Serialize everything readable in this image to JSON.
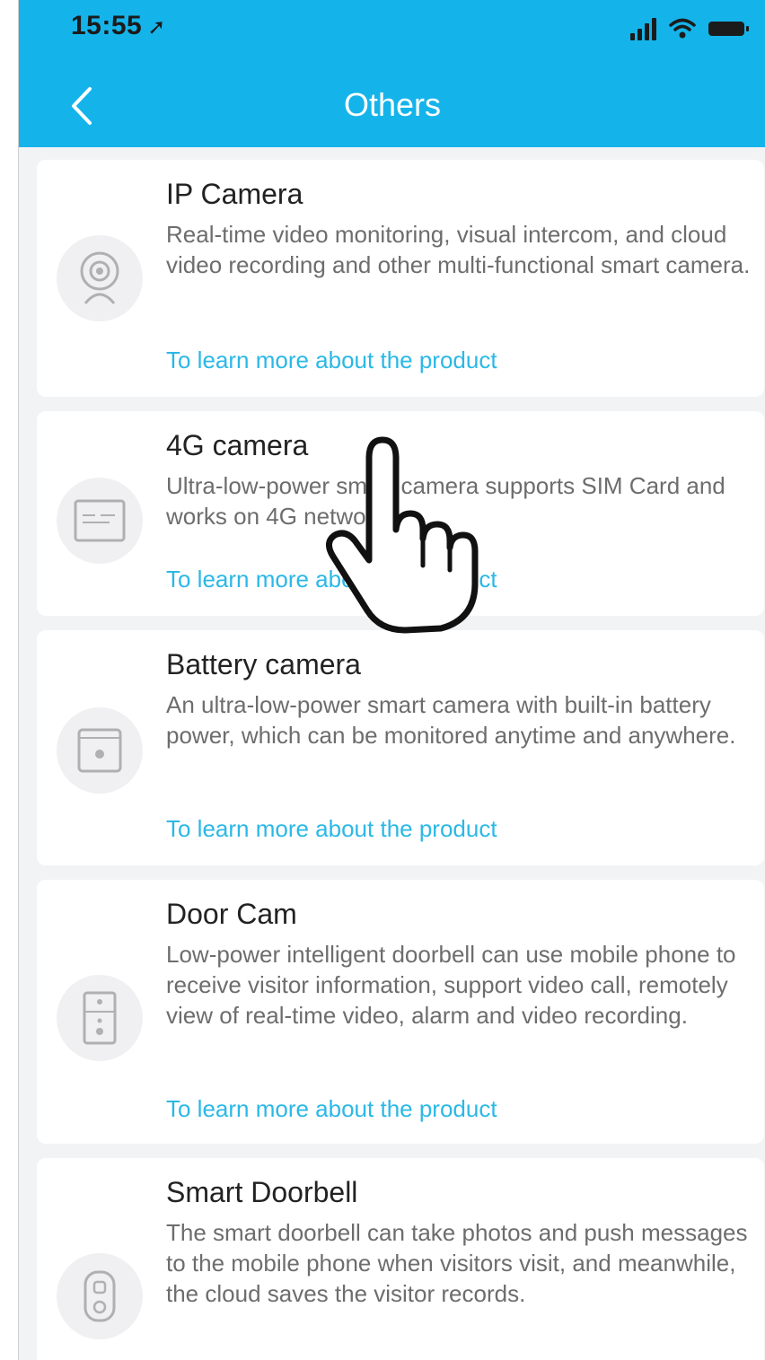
{
  "status_bar": {
    "time": "15:55",
    "location_arrow": "location-arrow-icon"
  },
  "header": {
    "title": "Others",
    "back_icon": "chevron-left-icon"
  },
  "colors": {
    "header": "#14b4ea",
    "link": "#2bb8e6",
    "card": "#ffffff",
    "background": "#f2f3f5"
  },
  "products": [
    {
      "title": "IP Camera",
      "desc": "Real-time video monitoring, visual intercom, and cloud video recording and other multi-functional smart camera.",
      "link": "To learn more about the product",
      "icon": "ip-camera-icon"
    },
    {
      "title": "4G camera",
      "desc": "Ultra-low-power smart camera supports SIM Card and works on 4G networks.",
      "link": "To learn more about the product",
      "icon": "4g-camera-icon"
    },
    {
      "title": "Battery camera",
      "desc": "An ultra-low-power smart camera with built-in battery power, which can be monitored anytime and anywhere.",
      "link": "To learn more about the product",
      "icon": "battery-camera-icon"
    },
    {
      "title": "Door Cam",
      "desc": "Low-power intelligent doorbell can use mobile phone to receive visitor information, support video call, remotely view of real-time video, alarm and video recording.",
      "link": "To learn more about the product",
      "icon": "door-cam-icon"
    },
    {
      "title": "Smart Doorbell",
      "desc": "The smart doorbell can take photos and push messages to the mobile phone when visitors visit, and meanwhile, the cloud saves the visitor records.",
      "link": "",
      "icon": "smart-doorbell-icon"
    }
  ],
  "overlay": {
    "icon": "pointing-hand-icon"
  }
}
